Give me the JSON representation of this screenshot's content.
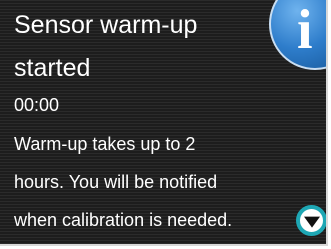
{
  "notification": {
    "title_line1": "Sensor warm-up",
    "title_line2": "started",
    "time": "00:00",
    "body_line1": "Warm-up takes up to 2",
    "body_line2": "hours. You will be notified",
    "body_line3": "when calibration is needed."
  },
  "icons": {
    "info": "info-icon",
    "info_glyph": "i",
    "scroll": "chevron-down-icon"
  },
  "colors": {
    "background": "#232323",
    "text": "#ffffff",
    "info_blue": "#2e7dcb",
    "scroll_ring": "#1ea7b4"
  }
}
